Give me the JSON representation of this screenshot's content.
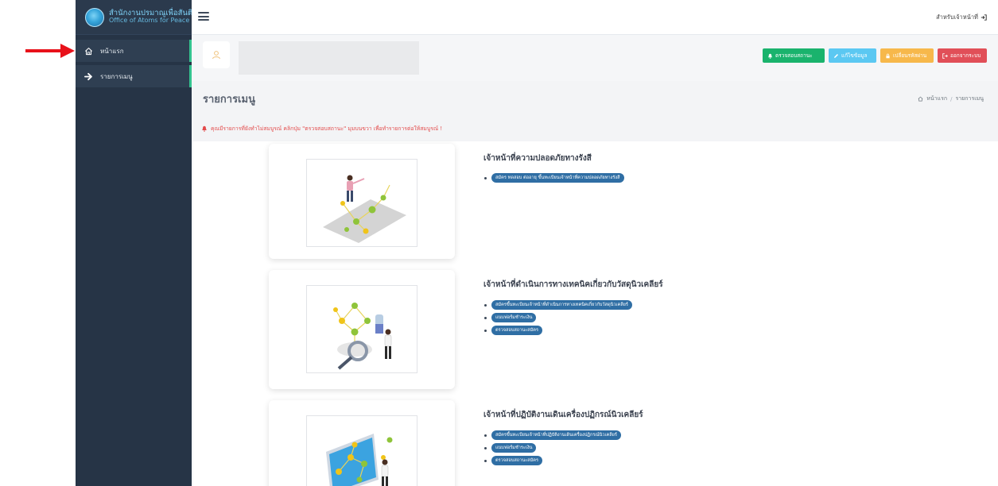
{
  "brand": {
    "name_th": "สำนักงานปรมาณูเพื่อสันติ",
    "name_en": "Office of Atoms for Peace"
  },
  "sidebar": {
    "items": [
      {
        "label": "หน้าแรก",
        "icon": "home-icon"
      },
      {
        "label": "รายการเมนู",
        "icon": "arrow-right-icon"
      }
    ]
  },
  "topbar": {
    "user_label": "สำหรับเจ้าหน้าที่"
  },
  "actions": {
    "status": "ตรวจสอบสถานะ",
    "edit": "แก้ไขข้อมูล",
    "password": "เปลี่ยนรหัสผ่าน",
    "logout": "ออกจากระบบ"
  },
  "page": {
    "title": "รายการเมนู",
    "breadcrumb": {
      "home": "หน้าแรก",
      "current": "รายการเมนู"
    },
    "alert": "คุณมีรายการที่ยังทำไม่สมบูรณ์ คลิกปุ่ม \"ตรวจสอบสถานะ\" มุมบนขวา เพื่อทำรายการต่อให้สมบูรณ์ !"
  },
  "sections": [
    {
      "title": "เจ้าหน้าที่ความปลอดภัยทางรังสี",
      "links": [
        "สมัคร ทดสอบ ต่ออายุ ขึ้นทะเบียนเจ้าหน้าที่ความปลอดภัยทางรังสี"
      ]
    },
    {
      "title": "เจ้าหน้าที่ดำเนินการทางเทคนิคเกี่ยวกับวัสดุนิวเคลียร์",
      "links": [
        "สมัครขึ้นทะเบียนเจ้าหน้าที่ดำเนินการทางเทคนิคเกี่ยวกับวัสดุนิวเคลียร์",
        "แนบฟอร์มชำระเงิน",
        "ตรวจสอบสถานะสมัคร"
      ]
    },
    {
      "title": "เจ้าหน้าที่ปฏิบัติงานเดินเครื่องปฏิกรณ์นิวเคลียร์",
      "links": [
        "สมัครขึ้นทะเบียนเจ้าหน้าที่ปฏิบัติงานเดินเครื่องปฏิกรณ์นิวเคลียร์",
        "แนบฟอร์มชำระเงิน",
        "ตรวจสอบสถานะสมัคร"
      ]
    }
  ],
  "colors": {
    "sidebar": "#263446",
    "accent_green": "#1ab36d",
    "accent_blue": "#5bc8f2",
    "accent_orange": "#f7b84b",
    "accent_red": "#e14f58",
    "pill": "#2f6ea4",
    "alert": "#e34b4b"
  }
}
